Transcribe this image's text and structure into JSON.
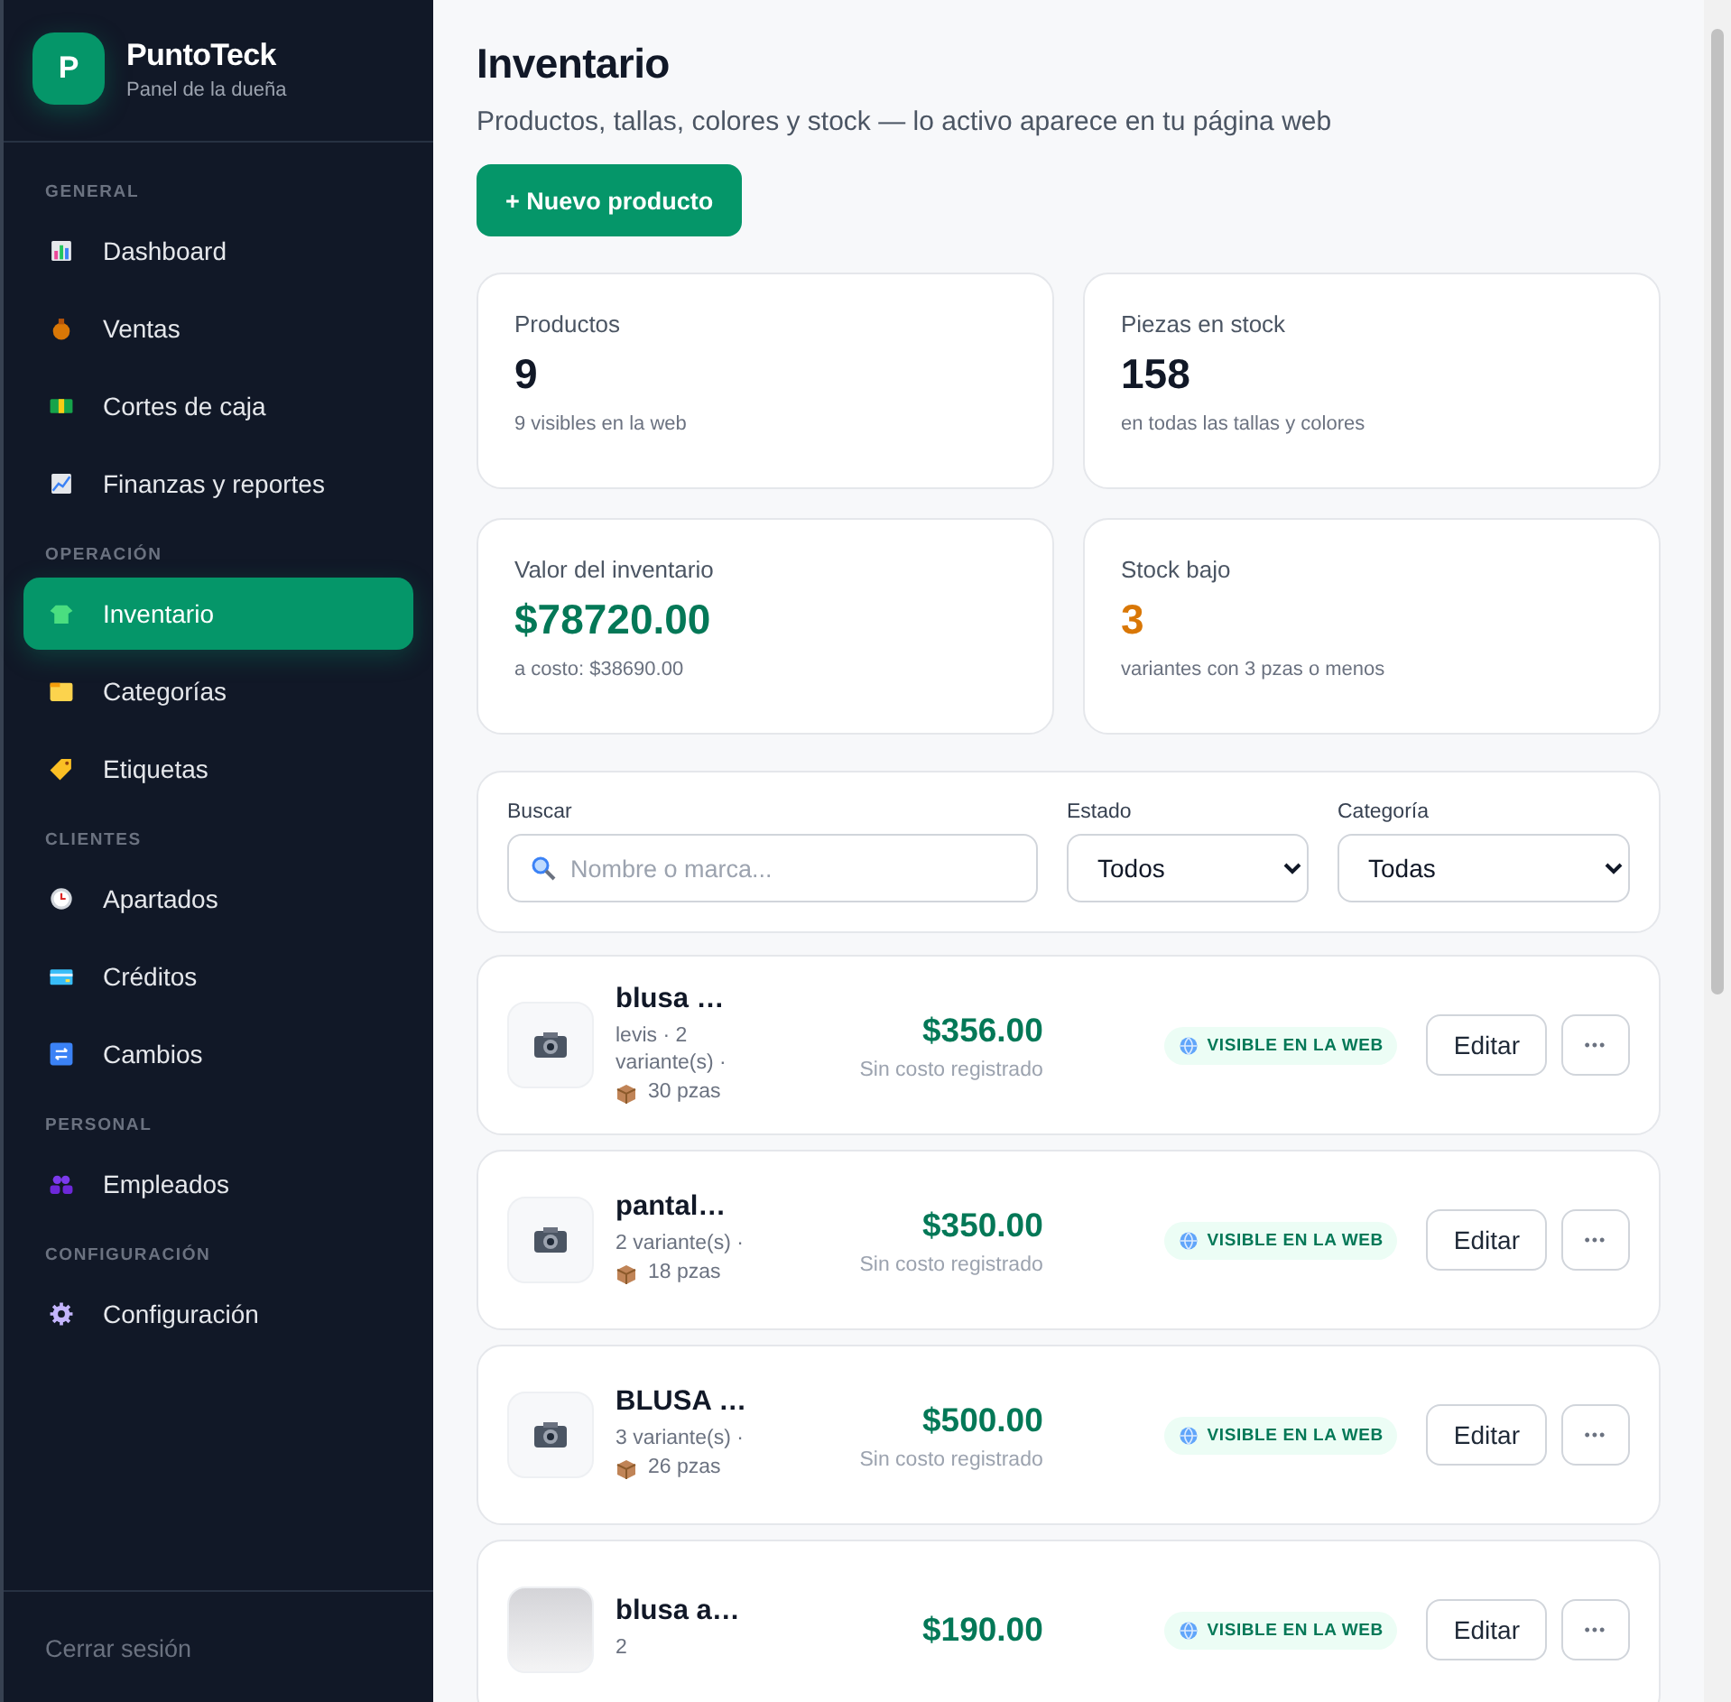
{
  "sidebar": {
    "logo_letter": "P",
    "brand": "PuntoTeck",
    "subtitle": "Panel de la dueña",
    "sections": [
      {
        "title": "GENERAL",
        "items": [
          {
            "label": "Dashboard",
            "selected": false
          },
          {
            "label": "Ventas",
            "selected": false
          },
          {
            "label": "Cortes de caja",
            "selected": false
          },
          {
            "label": "Finanzas y reportes",
            "selected": false
          }
        ]
      },
      {
        "title": "OPERACIÓN",
        "items": [
          {
            "label": "Inventario",
            "selected": true
          },
          {
            "label": "Categorías",
            "selected": false
          },
          {
            "label": "Etiquetas",
            "selected": false
          }
        ]
      },
      {
        "title": "CLIENTES",
        "items": [
          {
            "label": "Apartados",
            "selected": false
          },
          {
            "label": "Créditos",
            "selected": false
          },
          {
            "label": "Cambios",
            "selected": false
          }
        ]
      },
      {
        "title": "PERSONAL",
        "items": [
          {
            "label": "Empleados",
            "selected": false
          }
        ]
      },
      {
        "title": "CONFIGURACIÓN",
        "items": [
          {
            "label": "Configuración",
            "selected": false
          }
        ]
      }
    ],
    "logout": "Cerrar sesión"
  },
  "header": {
    "title": "Inventario",
    "subtitle": "Productos, tallas, colores y stock — lo activo aparece en tu página web",
    "new_button": "+ Nuevo producto"
  },
  "stats": [
    {
      "label": "Productos",
      "value": "9",
      "note": "9 visibles en la web",
      "kind": "plain"
    },
    {
      "label": "Piezas en stock",
      "value": "158",
      "note": "en todas las tallas y colores",
      "kind": "plain"
    },
    {
      "label": "Valor del inventario",
      "value": "$78720.00",
      "note": "a costo: $38690.00",
      "kind": "money"
    },
    {
      "label": "Stock bajo",
      "value": "3",
      "note": "variantes con 3 pzas o menos",
      "kind": "warning"
    }
  ],
  "filters": {
    "search": {
      "label": "Buscar",
      "placeholder": "Nombre o marca..."
    },
    "status": {
      "label": "Estado",
      "value": "Todos"
    },
    "category": {
      "label": "Categoría",
      "value": "Todas"
    }
  },
  "products": [
    {
      "name": "blusa …",
      "photo": false,
      "meta": "levis · 2 variante(s) ·",
      "pieces": "30 pzas",
      "price": "$356.00",
      "cost_note": "Sin costo registrado",
      "badge": "VISIBLE EN LA WEB",
      "edit": "Editar",
      "more": "•••"
    },
    {
      "name": "pantal…",
      "photo": false,
      "meta": "2 variante(s) ·",
      "pieces": "18 pzas",
      "price": "$350.00",
      "cost_note": "Sin costo registrado",
      "badge": "VISIBLE EN LA WEB",
      "edit": "Editar",
      "more": "•••"
    },
    {
      "name": "BLUSA …",
      "photo": false,
      "meta": "3 variante(s) ·",
      "pieces": "26 pzas",
      "price": "$500.00",
      "cost_note": "Sin costo registrado",
      "badge": "VISIBLE EN LA WEB",
      "edit": "Editar",
      "more": "•••"
    },
    {
      "name": "blusa a…",
      "photo": true,
      "meta": "2",
      "price": "$190.00",
      "badge": "VISIBLE EN LA WEB",
      "edit": "Editar",
      "more": "•••"
    }
  ]
}
